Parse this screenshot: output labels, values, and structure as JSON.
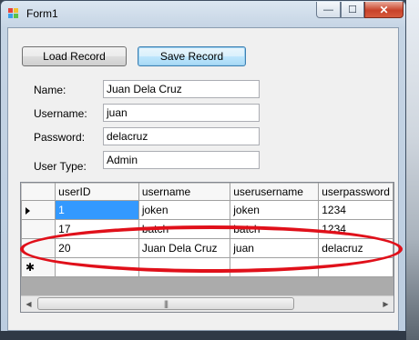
{
  "window": {
    "title": "Form1"
  },
  "caption_buttons": {
    "minimize": "—",
    "maximize": "☐",
    "close": "✕"
  },
  "buttons": {
    "load": "Load Record",
    "save": "Save Record"
  },
  "form": {
    "name_label": "Name:",
    "name_value": "Juan Dela Cruz",
    "username_label": "Username:",
    "username_value": "juan",
    "password_label": "Password:",
    "password_value": "delacruz",
    "usertype_label": "User Type:",
    "usertype_value": "Admin"
  },
  "grid": {
    "columns": [
      "userID",
      "username",
      "userusername",
      "userpassword"
    ],
    "rows": [
      [
        "1",
        "joken",
        "joken",
        "1234"
      ],
      [
        "17",
        "batch",
        "batch",
        "1234"
      ],
      [
        "20",
        "Juan Dela Cruz",
        "juan",
        "delacruz"
      ]
    ],
    "new_row_marker": "✱",
    "scroll_grip": "|||"
  },
  "colors": {
    "highlight_ellipse": "#e0101a",
    "selection": "#3399ff"
  }
}
